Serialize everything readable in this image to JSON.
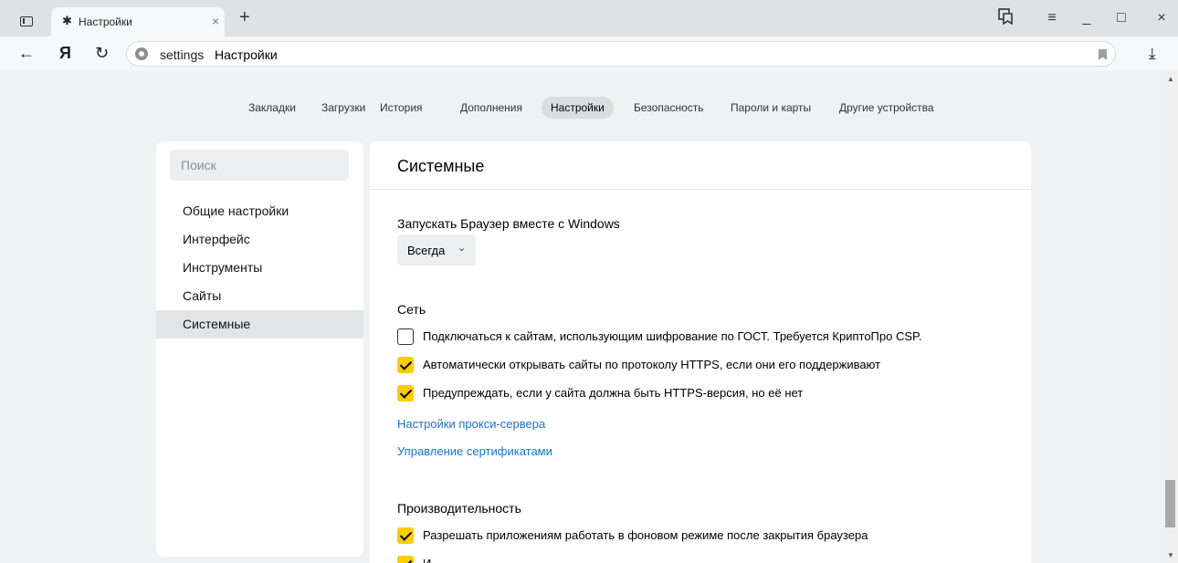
{
  "tab": {
    "title": "Настройки",
    "close": "×"
  },
  "new_tab": "+",
  "window": {
    "menu": "≡",
    "minimize": "_",
    "maximize": "□",
    "close": "×"
  },
  "address": {
    "host": "settings",
    "page_title": "Настройки"
  },
  "nav": {
    "back": "←",
    "logo": "Я",
    "reload": "↻",
    "download": "⤓"
  },
  "topnav": {
    "items": [
      "Закладки",
      "Загрузки",
      "История",
      "Дополнения",
      "Настройки",
      "Безопасность",
      "Пароли и карты",
      "Другие устройства"
    ],
    "active_index": 4
  },
  "sidebar": {
    "search_placeholder": "Поиск",
    "items": [
      "Общие настройки",
      "Интерфейс",
      "Инструменты",
      "Сайты",
      "Системные"
    ],
    "active_index": 4
  },
  "main": {
    "title": "Системные",
    "startup": {
      "label": "Запускать Браузер вместе с Windows",
      "value": "Всегда"
    },
    "network": {
      "heading": "Сеть",
      "options": [
        {
          "label": "Подключаться к сайтам, использующим шифрование по ГОСТ. Требуется КриптоПро CSP.",
          "checked": false
        },
        {
          "label": "Автоматически открывать сайты по протоколу HTTPS, если они его поддерживают",
          "checked": true
        },
        {
          "label": "Предупреждать, если у сайта должна быть HTTPS-версия, но её нет",
          "checked": true
        }
      ],
      "links": [
        "Настройки прокси-сервера",
        "Управление сертификатами"
      ]
    },
    "performance": {
      "heading": "Производительность",
      "options": [
        {
          "label": "Разрешать приложениям работать в фоновом режиме после закрытия браузера",
          "checked": true
        },
        {
          "label": "И",
          "checked": true
        }
      ]
    }
  },
  "colors": {
    "accent": "#ffcc00",
    "link": "#1a73c7"
  }
}
